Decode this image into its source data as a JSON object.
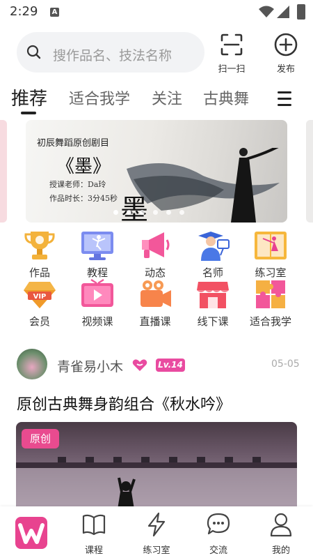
{
  "status_bar": {
    "time": "2:29",
    "sim_label": "A"
  },
  "search": {
    "placeholder": "搜作品名、技法名称"
  },
  "header_actions": {
    "scan_label": "扫一扫",
    "post_label": "发布"
  },
  "tabs": [
    {
      "label": "推荐",
      "active": true
    },
    {
      "label": "适合我学"
    },
    {
      "label": "关注"
    },
    {
      "label": "古典舞"
    }
  ],
  "banner": {
    "subtitle": "初辰舞蹈原创剧目",
    "title": "《墨》",
    "teacher": "授课老师：Da玲",
    "duration": "作品时长：3分45秒",
    "calligraphy": "墨",
    "dot_count": 6,
    "active_dot": 0
  },
  "grid": [
    {
      "label": "作品",
      "icon": "trophy-icon"
    },
    {
      "label": "教程",
      "icon": "monitor-dancer-icon"
    },
    {
      "label": "动态",
      "icon": "megaphone-icon"
    },
    {
      "label": "名师",
      "icon": "teacher-icon"
    },
    {
      "label": "练习室",
      "icon": "practice-room-icon"
    },
    {
      "label": "会员",
      "icon": "vip-diamond-icon",
      "badge": "VIP"
    },
    {
      "label": "视频课",
      "icon": "video-tv-icon"
    },
    {
      "label": "直播课",
      "icon": "live-camera-icon"
    },
    {
      "label": "线下课",
      "icon": "store-icon"
    },
    {
      "label": "适合我学",
      "icon": "puzzle-icon"
    }
  ],
  "post": {
    "username": "青雀易小木",
    "level": "Lv.14",
    "date": "05-05",
    "title": "原创古典舞身韵组合《秋水吟》",
    "badge": "原创"
  },
  "bottom_nav": [
    {
      "label": "",
      "icon": "home-logo-icon",
      "active": true
    },
    {
      "label": "课程",
      "icon": "book-icon"
    },
    {
      "label": "练习室",
      "icon": "lightning-icon"
    },
    {
      "label": "交流",
      "icon": "chat-icon"
    },
    {
      "label": "我的",
      "icon": "user-icon"
    }
  ],
  "colors": {
    "accent": "#e8438f",
    "vip": "#e94ba0"
  }
}
